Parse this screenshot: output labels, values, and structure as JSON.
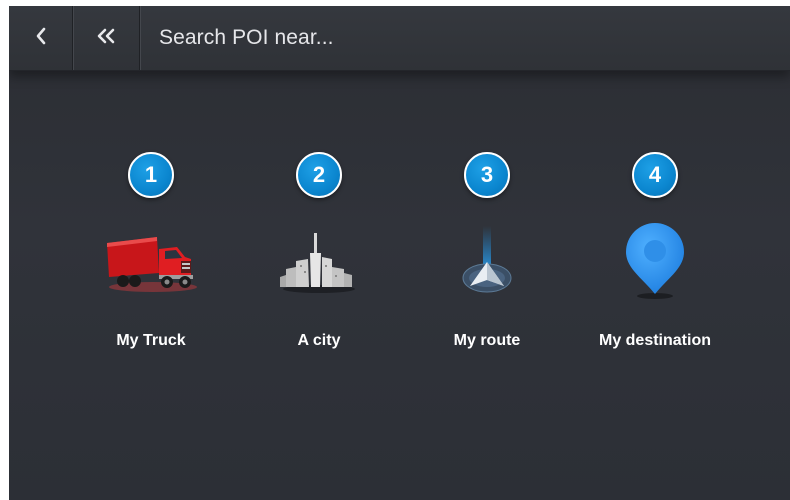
{
  "header": {
    "back_icon": "chevron-left-icon",
    "home_icon": "double-chevron-left-icon",
    "title": "Search POI near..."
  },
  "options": [
    {
      "number": "1",
      "label": "My Truck",
      "icon": "truck-icon"
    },
    {
      "number": "2",
      "label": "A city",
      "icon": "city-icon"
    },
    {
      "number": "3",
      "label": "My route",
      "icon": "route-arrow-icon"
    },
    {
      "number": "4",
      "label": "My destination",
      "icon": "destination-pin-icon"
    }
  ],
  "colors": {
    "badge": "#0b86cf",
    "background": "#2e3137",
    "text": "#ffffff",
    "truck": "#d81e1e",
    "pin": "#2b8ef0"
  }
}
